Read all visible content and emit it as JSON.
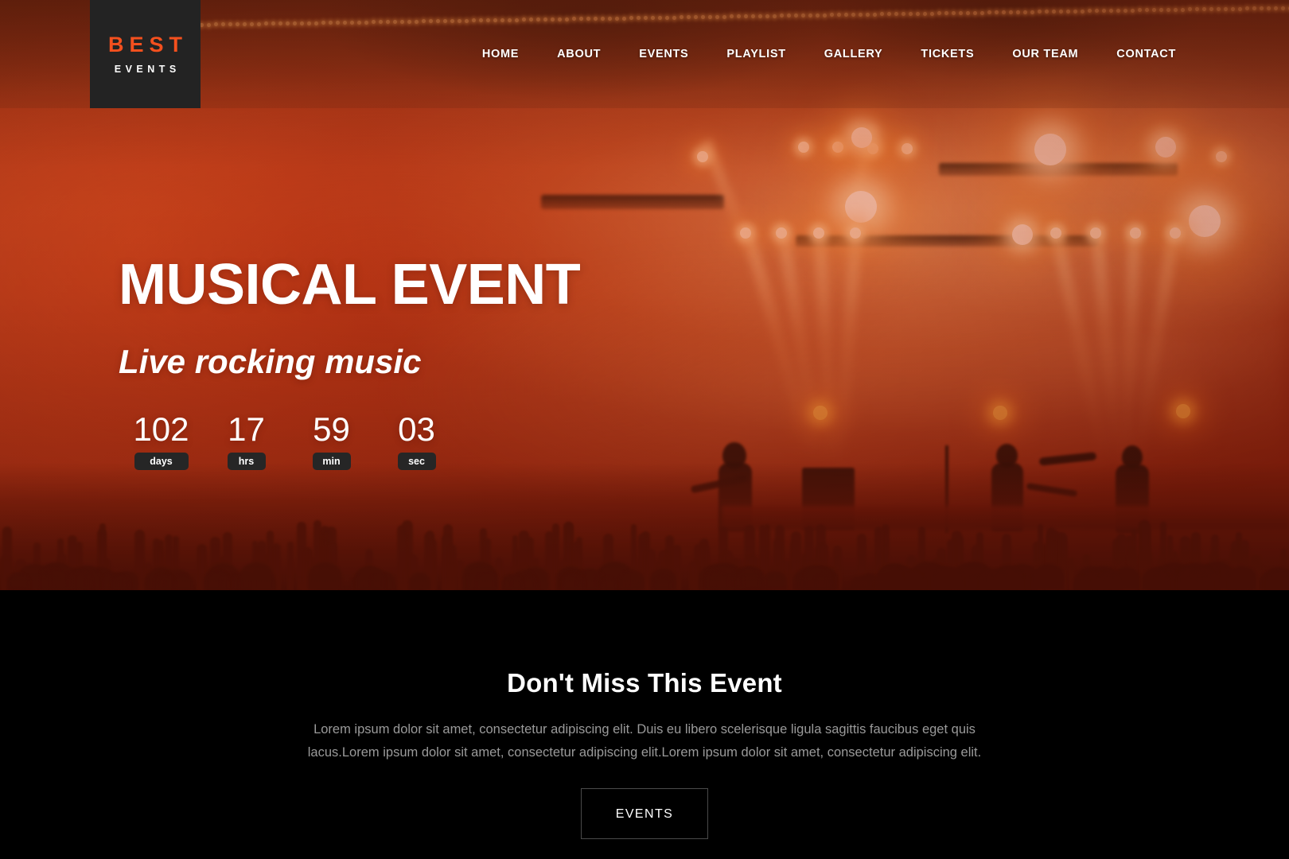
{
  "header": {
    "logo": {
      "primary": "BEST",
      "secondary": "EVENTS"
    },
    "nav": [
      {
        "label": "HOME",
        "name": "nav-home"
      },
      {
        "label": "ABOUT",
        "name": "nav-about"
      },
      {
        "label": "EVENTS",
        "name": "nav-events"
      },
      {
        "label": "PLAYLIST",
        "name": "nav-playlist"
      },
      {
        "label": "GALLERY",
        "name": "nav-gallery"
      },
      {
        "label": "TICKETS",
        "name": "nav-tickets"
      },
      {
        "label": "OUR TEAM",
        "name": "nav-our-team"
      },
      {
        "label": "CONTACT",
        "name": "nav-contact"
      }
    ]
  },
  "hero": {
    "title": "MUSICAL EVENT",
    "subtitle": "Live rocking music",
    "countdown": [
      {
        "value": "102",
        "label": "days"
      },
      {
        "value": "17",
        "label": "hrs"
      },
      {
        "value": "59",
        "label": "min"
      },
      {
        "value": "03",
        "label": "sec"
      }
    ]
  },
  "promo": {
    "heading": "Don't Miss This Event",
    "paragraph": "Lorem ipsum dolor sit amet, consectetur adipiscing elit. Duis eu libero scelerisque ligula sagittis faucibus eget quis lacus.Lorem ipsum dolor sit amet, consectetur adipiscing elit.Lorem ipsum dolor sit amet, consectetur adipiscing elit.",
    "button_label": "EVENTS"
  },
  "colors": {
    "accent": "#f4501e",
    "logo_block": "#232323",
    "badge": "#262626",
    "dark_section": "#000000",
    "body_text": "#9a9a9a",
    "button_border": "#4a4a4a"
  }
}
